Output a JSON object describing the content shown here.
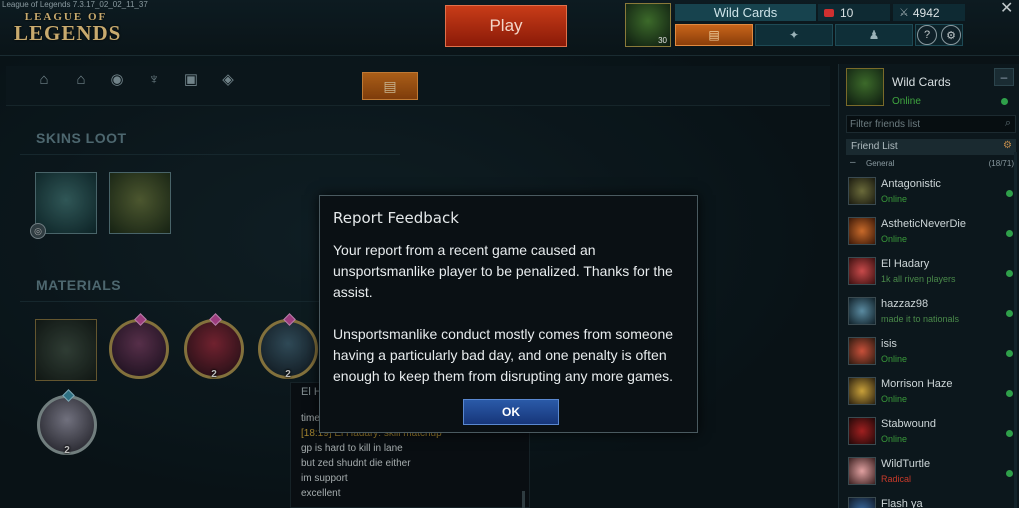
{
  "window": {
    "title": "League of Legends 7.3.17_02_02_11_37"
  },
  "logo": {
    "line1": "LEAGUE OF",
    "line2": "LEGENDS"
  },
  "header": {
    "play_label": "Play",
    "profile_level": "30",
    "summoner_name": "Wild Cards",
    "rp": "10",
    "ip": "4942",
    "help_label": "?",
    "close_label": "✕"
  },
  "loot": {
    "sections": {
      "skins": "SKINS LOOT",
      "materials": "MATERIALS"
    },
    "material_counts": [
      "2",
      "2",
      "2"
    ]
  },
  "chat": {
    "title": "El H",
    "lines": [
      {
        "text": "time"
      },
      {
        "timestamp": "[18:19]",
        "text": " El Hadary: skill matchup"
      },
      {
        "text": "gp is hard to kill in lane"
      },
      {
        "text": "but zed shudnt die either"
      },
      {
        "text": "im support"
      },
      {
        "text": "excellent"
      }
    ]
  },
  "sidebar": {
    "me": {
      "name": "Wild Cards",
      "status": "Online",
      "minimize_label": "–"
    },
    "filter_placeholder": "Filter friends list",
    "friend_list_label": "Friend List",
    "group": {
      "name": "General",
      "count": "(18/71)"
    },
    "friends": [
      {
        "name": "Antagonistic",
        "status": "Online"
      },
      {
        "name": "AstheticNeverDie",
        "status": "Online"
      },
      {
        "name": "El Hadary",
        "status": "1k all riven players"
      },
      {
        "name": "hazzaz98",
        "status": "made it to nationals"
      },
      {
        "name": "isis",
        "status": "Online"
      },
      {
        "name": "Morrison Haze",
        "status": "Online"
      },
      {
        "name": "Stabwound",
        "status": "Online"
      },
      {
        "name": "WildTurtle",
        "status": "Radical"
      },
      {
        "name": "Flash ya",
        "status": ""
      }
    ]
  },
  "dialog": {
    "title": "Report Feedback",
    "paragraph1": "Your report from a recent game caused an unsportsmanlike player to be penalized. Thanks for the assist.",
    "paragraph2": "Unsportsmanlike conduct mostly comes from someone having a particularly bad day, and one penalty is often enough to keep them from disrupting any more games.",
    "ok_label": "OK"
  },
  "colors": {
    "accent_online": "#2fa04a",
    "play_button": "#c83c18",
    "ok_button": "#2a5aa8"
  }
}
